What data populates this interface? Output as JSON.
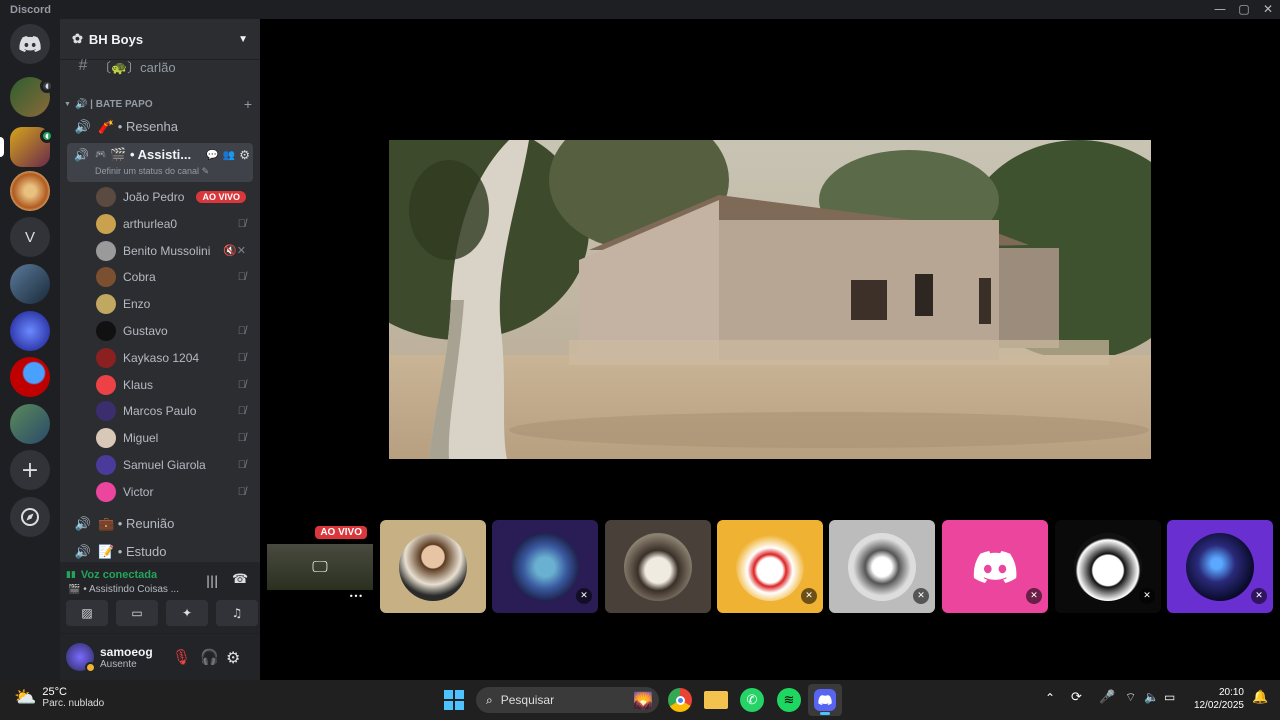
{
  "window": {
    "app_title": "Discord"
  },
  "server": {
    "name": "BH Boys"
  },
  "channels": {
    "top_channel": "〔🐢〕carlão",
    "category": "🔊 | BATE PAPO",
    "voice1": "🧨 • Resenha",
    "active_voice": "🎬 • Assisti...",
    "active_status_hint": "Definir um status do canal",
    "voice3": "💼 • Reunião",
    "voice4": "📝 • Estudo"
  },
  "members": [
    {
      "name": "João Pedro",
      "live": "AO VIVO",
      "color": "#5a4a3f"
    },
    {
      "name": "arthurlea0",
      "color": "#c9a14f"
    },
    {
      "name": "Benito Mussolini",
      "color": "#9a9a9a"
    },
    {
      "name": "Cobra",
      "color": "#7a5030"
    },
    {
      "name": "Enzo",
      "color": "#c0a860"
    },
    {
      "name": "Gustavo",
      "color": "#111111"
    },
    {
      "name": "Kaykaso 1204",
      "color": "#8b2020"
    },
    {
      "name": "Klaus",
      "color": "#ed4245"
    },
    {
      "name": "Marcos Paulo",
      "color": "#3b2d6e"
    },
    {
      "name": "Miguel",
      "color": "#d8c8b8"
    },
    {
      "name": "Samuel Giarola",
      "color": "#4a3a9a"
    },
    {
      "name": "Victor",
      "color": "#eb459e"
    }
  ],
  "voice_panel": {
    "status": "Voz conectada",
    "channel": "🎬 • Assistindo Coisas ..."
  },
  "user": {
    "name": "samoeog",
    "status": "Ausente"
  },
  "stream": {
    "live_label": "AO VIVO",
    "more": "•••"
  },
  "taskbar": {
    "weather_temp": "25°C",
    "weather_desc": "Parc. nublado",
    "search_placeholder": "Pesquisar",
    "time": "20:10",
    "date": "12/02/2025"
  },
  "colors": {
    "accent_green": "#23a55a",
    "live_red": "#da373c",
    "discord_blurple": "#5865f2"
  }
}
